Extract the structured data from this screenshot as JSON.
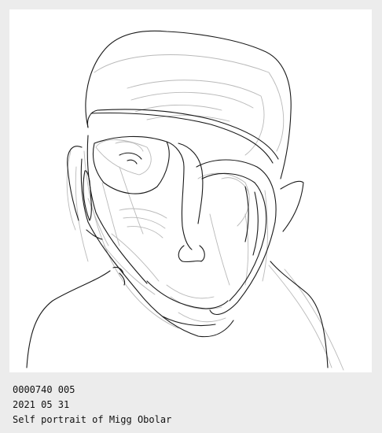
{
  "artwork": {
    "icon": "line-drawing-portrait",
    "caption": {
      "id_line": "0000740 005",
      "date_line": "2021 05 31",
      "title_line": "Self portrait of Migg Obolar"
    }
  }
}
